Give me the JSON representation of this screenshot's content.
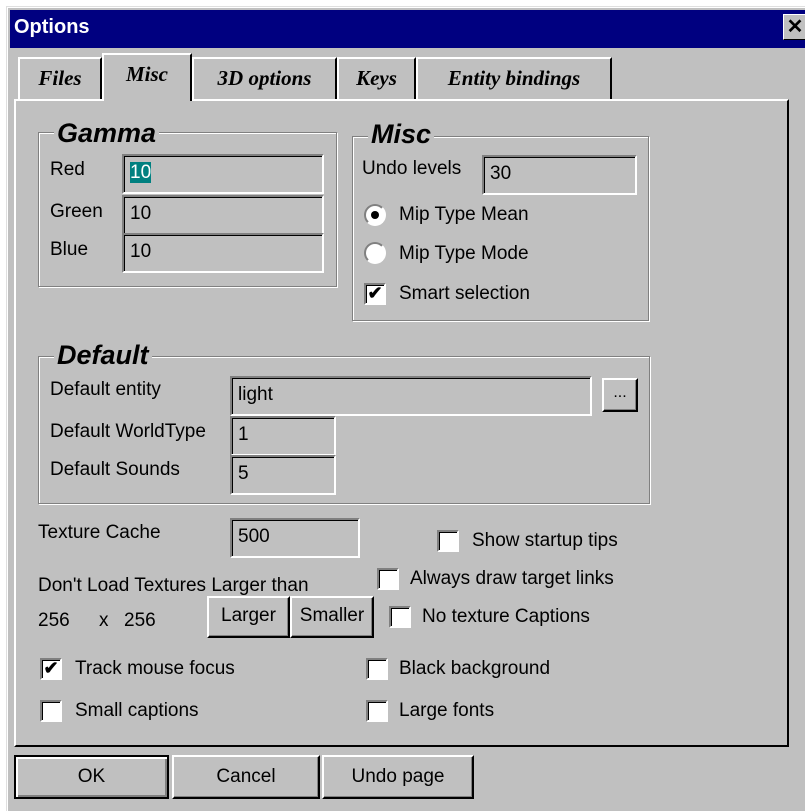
{
  "window": {
    "title": "Options",
    "close_glyph": "✕"
  },
  "tabs": [
    {
      "label": "Files"
    },
    {
      "label": "Misc"
    },
    {
      "label": "3D options"
    },
    {
      "label": "Keys"
    },
    {
      "label": "Entity bindings"
    }
  ],
  "active_tab": "Misc",
  "gamma": {
    "legend": "Gamma",
    "red_label": "Red",
    "red_value": "10",
    "green_label": "Green",
    "green_value": "10",
    "blue_label": "Blue",
    "blue_value": "10"
  },
  "misc": {
    "legend": "Misc",
    "undo_label": "Undo levels",
    "undo_value": "30",
    "mip_mean_label": "Mip Type Mean",
    "mip_mean_selected": true,
    "mip_mode_label": "Mip Type Mode",
    "mip_mode_selected": false,
    "smart_selection_label": "Smart selection",
    "smart_selection_checked": true
  },
  "default": {
    "legend": "Default",
    "entity_label": "Default entity",
    "entity_value": "light",
    "browse_label": "...",
    "worldtype_label": "Default WorldType",
    "worldtype_value": "1",
    "sounds_label": "Default Sounds",
    "sounds_value": "5"
  },
  "texture": {
    "cache_label": "Texture Cache",
    "cache_value": "500",
    "dont_load_label": "Don't Load Textures Larger than",
    "width": "256",
    "x_sep": "x",
    "height": "256",
    "larger_label": "Larger",
    "smaller_label": "Smaller"
  },
  "checks": {
    "show_startup_tips": {
      "label": "Show startup tips",
      "checked": false
    },
    "always_draw_target_links": {
      "label": "Always draw target links",
      "checked": false
    },
    "no_texture_captions": {
      "label": "No texture Captions",
      "checked": false
    },
    "track_mouse_focus": {
      "label": "Track mouse focus",
      "checked": true
    },
    "small_captions": {
      "label": "Small captions",
      "checked": false
    },
    "black_background": {
      "label": "Black background",
      "checked": false
    },
    "large_fonts": {
      "label": "Large fonts",
      "checked": false
    }
  },
  "buttons": {
    "ok": "OK",
    "cancel": "Cancel",
    "undo_page": "Undo page"
  },
  "colors": {
    "titlebar": "#000080",
    "face": "#c0c0c0",
    "selection": "#008080"
  }
}
